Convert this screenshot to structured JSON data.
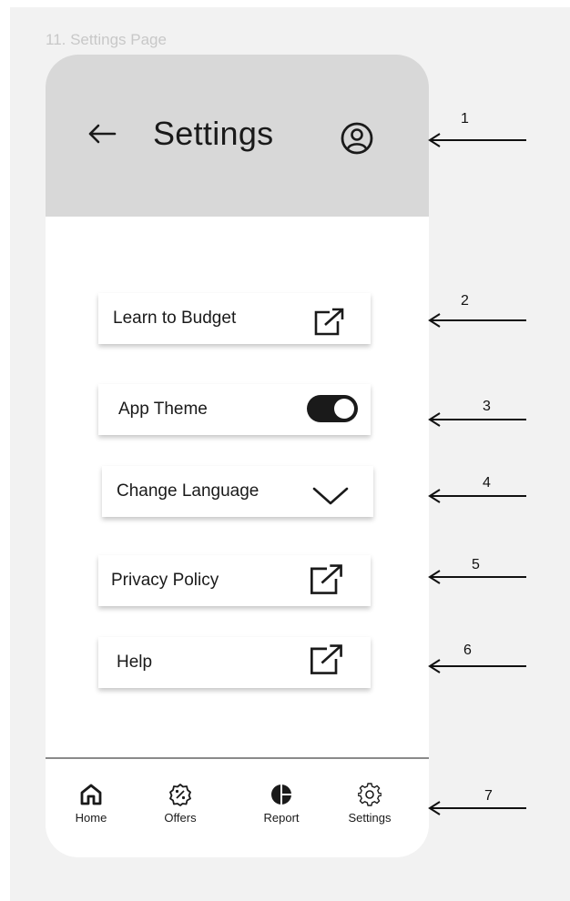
{
  "page_label": "11. Settings Page",
  "header": {
    "title": "Settings"
  },
  "icons": {
    "back": "left-arrow-icon",
    "profile": "user-circle-icon",
    "external": "external-link-icon",
    "toggle": "toggle-switch-icon",
    "dropdown": "chevron-down-icon"
  },
  "settings": {
    "learn_to_budget": "Learn to Budget",
    "app_theme": "App Theme",
    "app_theme_on": true,
    "change_language": "Change Language",
    "privacy_policy": "Privacy Policy",
    "help": "Help"
  },
  "nav": {
    "home": "Home",
    "offers": "Offers",
    "report": "Report",
    "settings": "Settings"
  },
  "annotations": [
    "1",
    "2",
    "3",
    "4",
    "5",
    "6",
    "7"
  ],
  "colors": {
    "header_bg": "#d8d8d8",
    "canvas_bg": "#f2f2f2",
    "ink": "#1a1a1a"
  }
}
